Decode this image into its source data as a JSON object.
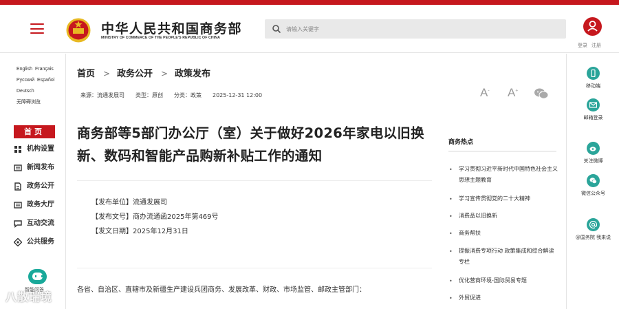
{
  "colors": {
    "brand_red": "#c6181e",
    "accent_teal": "#2ba59a",
    "text": "#333333"
  },
  "header": {
    "logo_cn": "中华人民共和国商务部",
    "logo_en": "MINISTRY OF COMMERCE OF THE PEOPLE'S REPUBLIC OF CHINA",
    "search_placeholder": "请输入关键字",
    "login": "登录",
    "register": "注册"
  },
  "languages": [
    "English",
    "Français",
    "Русский",
    "Español",
    "Deutsch",
    "无障碍浏览"
  ],
  "leftnav": {
    "home": "首页",
    "items": [
      {
        "label": "机构设置",
        "icon": "org-structure-icon"
      },
      {
        "label": "新闻发布",
        "icon": "news-icon"
      },
      {
        "label": "政务公开",
        "icon": "document-icon"
      },
      {
        "label": "政务大厅",
        "icon": "hall-icon"
      },
      {
        "label": "互动交流",
        "icon": "chat-icon"
      },
      {
        "label": "公共服务",
        "icon": "service-icon"
      }
    ],
    "robot_label": "智能问答"
  },
  "breadcrumb": [
    "首页",
    "政务公开",
    "政策发布"
  ],
  "meta": {
    "source": "来源：流通发展司",
    "type": "类型：原创",
    "category": "分类：政策",
    "datetime": "2025-12-31 12:00"
  },
  "article": {
    "title": "商务部等5部门办公厅（室）关于做好2026年家电以旧换新、数码和智能产品购新补贴工作的通知",
    "issuer": "【发布单位】流通发展司",
    "doc_no": "【发布文号】商办流通函2025年第469号",
    "date": "【发文日期】2025年12月31日",
    "body_start": "各省、自治区、直辖市及新疆生产建设兵团商务、发展改革、财政、市场监管、邮政主管部门："
  },
  "hot": {
    "title": "商务热点",
    "items": [
      "学习贯彻习近平新时代中国特色社会主义思想主题教育",
      "学习宣传贯彻党的二十大精神",
      "消费品以旧换新",
      "商务帮扶",
      "提振消费专项行动 政策集成和综合解读专栏",
      "优化营商环境-国际贸易专题",
      "外贸促进"
    ]
  },
  "rightbar": [
    {
      "label": "移动端",
      "icon": "mobile-icon"
    },
    {
      "label": "邮箱登录",
      "icon": "mail-icon"
    },
    {
      "label": "关注微博",
      "icon": "weibo-icon"
    },
    {
      "label": "微信公众号",
      "icon": "wechat-icon"
    },
    {
      "label": "@国务院 我来说",
      "icon": "at-icon"
    }
  ],
  "watermark": "八散瑞境"
}
